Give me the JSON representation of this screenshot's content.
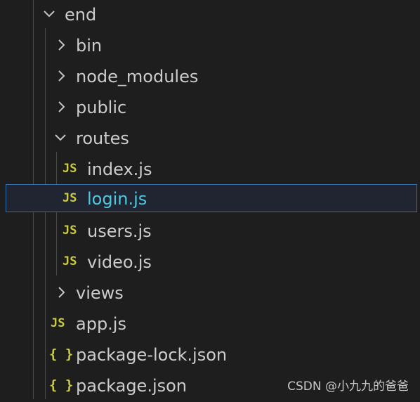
{
  "explorer": {
    "items": [
      {
        "label": "end",
        "type": "folder-open"
      },
      {
        "label": "bin",
        "type": "folder-closed"
      },
      {
        "label": "node_modules",
        "type": "folder-closed"
      },
      {
        "label": "public",
        "type": "folder-closed"
      },
      {
        "label": "routes",
        "type": "folder-open"
      },
      {
        "label": "index.js",
        "type": "js-file",
        "icon": "JS"
      },
      {
        "label": "login.js",
        "type": "js-file",
        "icon": "JS",
        "selected": true
      },
      {
        "label": "users.js",
        "type": "js-file",
        "icon": "JS"
      },
      {
        "label": "video.js",
        "type": "js-file",
        "icon": "JS"
      },
      {
        "label": "views",
        "type": "folder-closed"
      },
      {
        "label": "app.js",
        "type": "js-file",
        "icon": "JS"
      },
      {
        "label": "package-lock.json",
        "type": "json-file",
        "icon": "{ }"
      },
      {
        "label": "package.json",
        "type": "json-file",
        "icon": "{ }"
      }
    ]
  },
  "watermark": "CSDN @小九九的爸爸",
  "colors": {
    "background": "#1e1e1f",
    "text": "#cccccc",
    "selected_text": "#4ec9e2",
    "selected_border": "#2f6fad",
    "js_icon": "#cbcb41"
  }
}
